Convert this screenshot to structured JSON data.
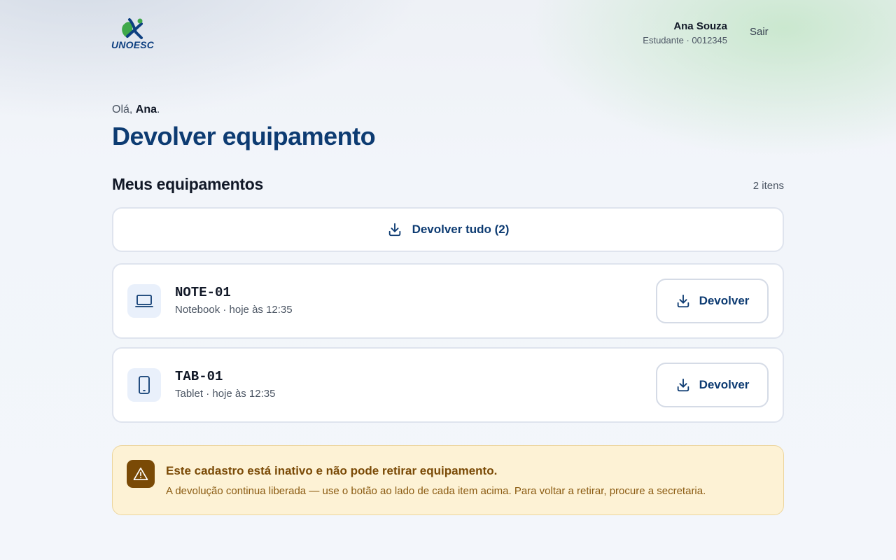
{
  "header": {
    "logo_text": "UNOESC",
    "user_name": "Ana Souza",
    "user_meta": "Estudante · 0012345",
    "logout_label": "Sair"
  },
  "main": {
    "greeting_prefix": "Olá, ",
    "greeting_name": "Ana",
    "greeting_suffix": ".",
    "title": "Devolver equipamento",
    "section_title": "Meus equipamentos",
    "item_count": "2 itens",
    "return_all_label": "Devolver tudo (2)",
    "items": [
      {
        "code": "NOTE-01",
        "subtitle": "Notebook · hoje às 12:35",
        "icon": "laptop-icon",
        "button_label": "Devolver"
      },
      {
        "code": "TAB-01",
        "subtitle": "Tablet · hoje às 12:35",
        "icon": "tablet-icon",
        "button_label": "Devolver"
      }
    ]
  },
  "alert": {
    "icon": "warning-icon",
    "title": "Este cadastro está inativo e não pode retirar equipamento.",
    "text": "A devolução continua liberada — use o botão ao lado de cada item acima. Para voltar a retirar, procure a secretaria."
  },
  "colors": {
    "primary": "#0d3b72",
    "alert_bg": "#fdf2d5",
    "alert_accent": "#7a4a06",
    "logo_green": "#3fa84a"
  }
}
